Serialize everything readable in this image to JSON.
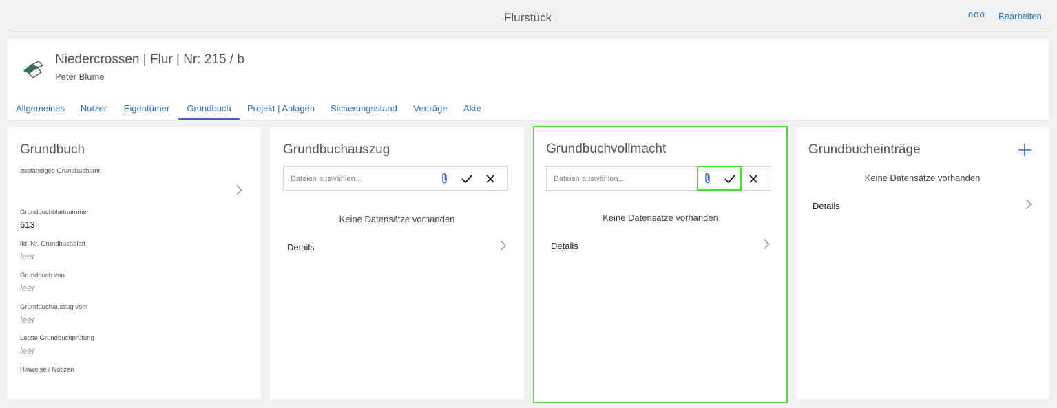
{
  "topbar": {
    "title": "Flurstück",
    "more": "ooo",
    "edit": "Bearbeiten"
  },
  "header": {
    "icon": "parcel-icon",
    "title": "Niedercrossen | Flur | Nr: 215 / b",
    "subtitle": "Peter Blume",
    "tabs": [
      "Allgemeines",
      "Nutzer",
      "Eigentümer",
      "Grundbuch",
      "Projekt | Anlagen",
      "Sicherungsstand",
      "Verträge",
      "Akte"
    ],
    "active_tab": "Grundbuch"
  },
  "grundbuch": {
    "title": "Grundbuch",
    "fields": [
      {
        "label": "zuständiges Grundbuchamt",
        "value": ""
      },
      {
        "label": "Grundbuchblattnummer",
        "value": "613"
      },
      {
        "label": "lfd. Nr. Grundbuchblatt",
        "value": "leer"
      },
      {
        "label": "Grundbuch von",
        "value": "leer"
      },
      {
        "label": "Grundbuchauszug vom",
        "value": "leer"
      },
      {
        "label": "Letzte Grundbuchprüfung",
        "value": "leer"
      },
      {
        "label": "Hinweise / Notizen",
        "value": ""
      }
    ]
  },
  "auszug": {
    "title": "Grundbuchauszug",
    "placeholder": "Dateien auswählen...",
    "empty": "Keine Datensätze vorhanden",
    "details": "Details"
  },
  "vollmacht": {
    "title": "Grundbuchvollmacht",
    "placeholder": "Dateien auswählen...",
    "empty": "Keine Datensätze vorhanden",
    "details": "Details"
  },
  "eintraege": {
    "title": "Grundbucheinträge",
    "empty": "Keine Datensätze vorhanden",
    "details": "Details"
  },
  "colors": {
    "accent": "#2b6fb8",
    "highlight": "#44e22a",
    "clip": "#3f5dcf"
  }
}
